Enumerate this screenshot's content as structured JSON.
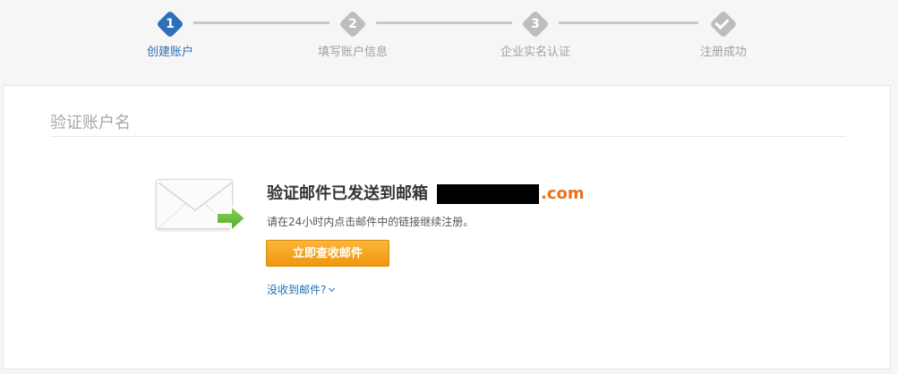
{
  "stepper": {
    "steps": [
      {
        "num": "1",
        "label": "创建账户",
        "state": "active"
      },
      {
        "num": "2",
        "label": "填写账户信息",
        "state": "pending"
      },
      {
        "num": "3",
        "label": "企业实名认证",
        "state": "pending"
      },
      {
        "num": "",
        "label": "注册成功",
        "state": "pending",
        "icon": "check-icon"
      }
    ]
  },
  "card": {
    "title": "验证账户名",
    "message_prefix": "验证邮件已发送到邮箱",
    "email_domain": ".com",
    "instruction": "请在24小时内点击邮件中的链接继续注册。",
    "check_mail_button": "立即查收邮件",
    "not_received_link": "没收到邮件?"
  },
  "colors": {
    "active_step": "#2d6fb8",
    "inactive_step": "#bdbdbd",
    "button": "#f0960d",
    "domain_text": "#e8731c",
    "link": "#1f6fb5"
  }
}
